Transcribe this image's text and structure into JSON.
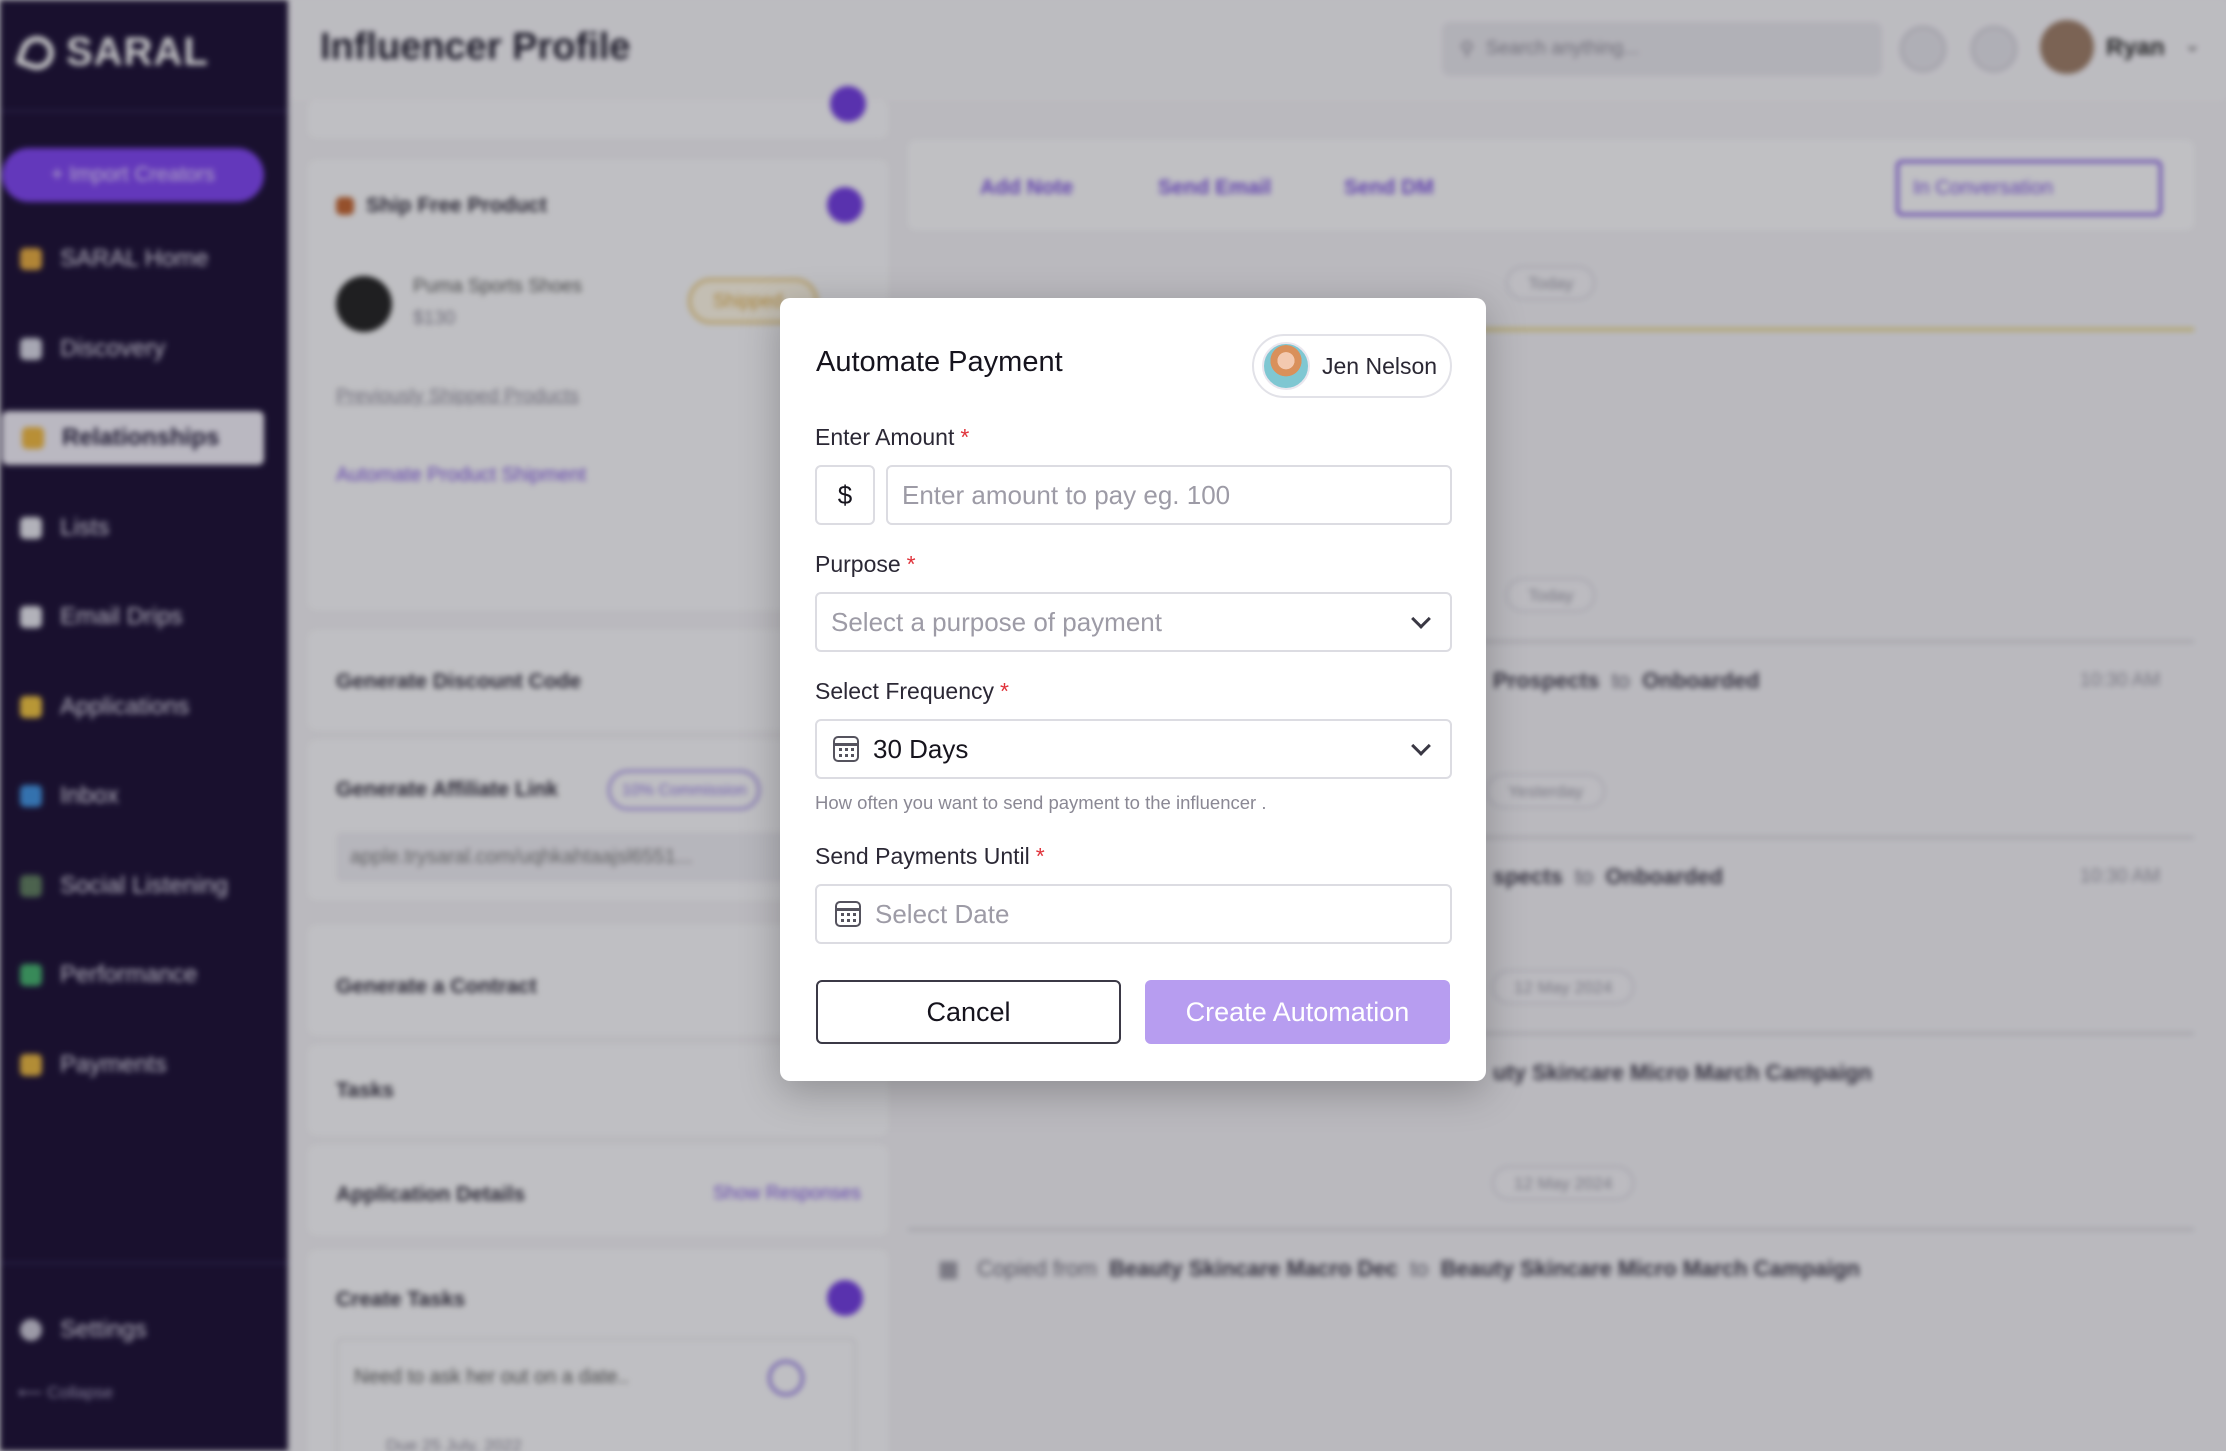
{
  "sidebar": {
    "brand": "SARAL",
    "import_button": "+ Import Creators",
    "items": [
      {
        "label": "SARAL Home",
        "color": "#e6a93a"
      },
      {
        "label": "Discovery",
        "color": "#d8d8e6"
      },
      {
        "label": "Relationships",
        "color": "#f0b73a"
      },
      {
        "label": "Lists",
        "color": "#e8e8f0"
      },
      {
        "label": "Email Drips",
        "color": "#e8e8f0"
      },
      {
        "label": "Applications",
        "color": "#f0c23a"
      },
      {
        "label": "Inbox",
        "color": "#3a8fe0"
      },
      {
        "label": "Social Listening",
        "color": "#5a7a5a"
      },
      {
        "label": "Performance",
        "color": "#3fb06a"
      },
      {
        "label": "Payments",
        "color": "#e8b43a"
      }
    ],
    "active_index": 2,
    "settings": "Settings",
    "collapse": "⟵ Collapse"
  },
  "topbar": {
    "title": "Influencer Profile",
    "search_placeholder": "Search anything...",
    "user_name": "Ryan"
  },
  "left_panel": {
    "ship_free_product": "Ship Free Product",
    "product_name": "Puma Sports Shoes",
    "product_price": "$130",
    "product_status": "Shipped",
    "previously_shipped": "Previously Shipped Products",
    "automate_shipment": "Automate Product Shipment",
    "discount_code": "Generate Discount Code",
    "affiliate_link": "Generate Affiliate Link",
    "commission_badge": "10% Commission",
    "affiliate_url": "apple.trysaral.com/uqhkahtaajsl6551...",
    "contract": "Generate a Contract",
    "tasks": "Tasks",
    "application_details": "Application Details",
    "show_responses": "Show Responses",
    "create_tasks": "Create Tasks",
    "task_text": "Need to ask her out on a date..",
    "task_due": "Due 25 July, 2022"
  },
  "right_panel": {
    "add_note": "Add Note",
    "send_email": "Send Email",
    "send_dm": "Send DM",
    "status": "In Conversation",
    "dates": [
      "Today",
      "Today",
      "Yesterday",
      "12 May 2024",
      "12 May 2024"
    ],
    "feed": [
      {
        "from": "Prospects",
        "to": "Onboarded",
        "time": "10:30 AM"
      },
      {
        "from": "spects",
        "to": "Onboarded",
        "time": "10:30 AM"
      },
      {
        "text": "uty Skincare Micro March Campaign"
      },
      {
        "prefix": "Copied from",
        "from": "Beauty Skincare Macro Dec",
        "to": "Beauty Skincare Micro March Campaign"
      }
    ],
    "connector": "to"
  },
  "modal": {
    "title": "Automate Payment",
    "influencer_name": "Jen Nelson",
    "amount_label": "Enter Amount",
    "currency": "$",
    "amount_placeholder": "Enter amount to pay eg. 100",
    "purpose_label": "Purpose",
    "purpose_placeholder": "Select a purpose of payment",
    "frequency_label": "Select Frequency",
    "frequency_value": "30 Days",
    "frequency_helper": "How often you want to send payment to the influencer .",
    "until_label": "Send Payments Until",
    "until_placeholder": "Select Date",
    "required_mark": "*",
    "cancel_label": "Cancel",
    "create_label": "Create Automation"
  },
  "colors": {
    "sidebar_bg": "#14082f",
    "accent": "#7b3ff2",
    "create_button": "#b79df0",
    "required": "#e0323a"
  }
}
